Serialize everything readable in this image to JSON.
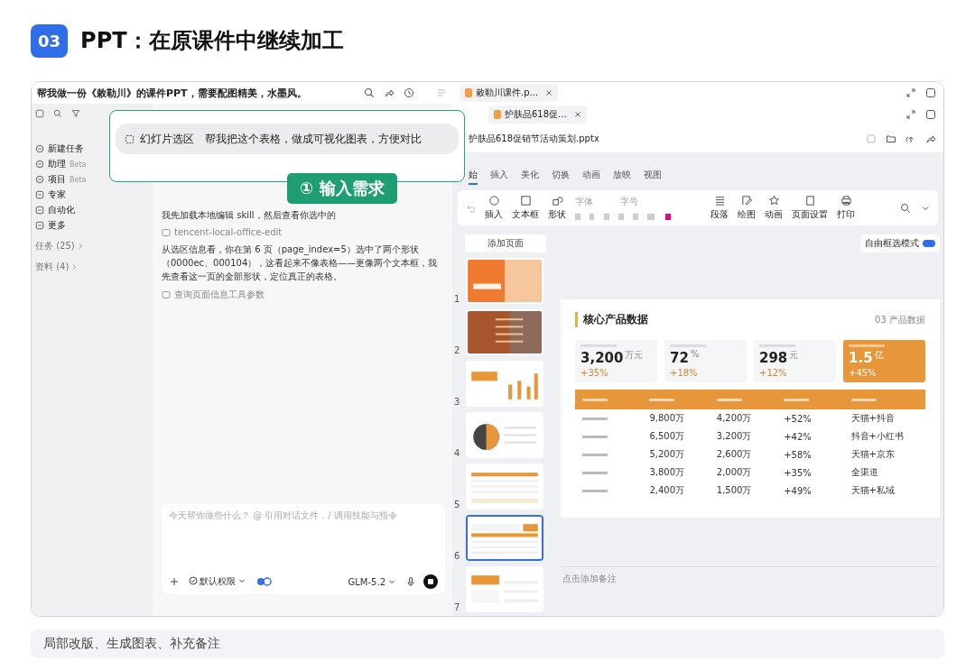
{
  "header": {
    "badge": "03",
    "title": "PPT：在原课件中继续加工"
  },
  "chat_window": {
    "title": "帮我做一份《敕勒川》的课件PPT，需要配图精美，水墨风。",
    "sidebar": {
      "items": [
        {
          "label": "新建任务"
        },
        {
          "label": "助理",
          "badge": "Beta"
        },
        {
          "label": "项目",
          "badge": "Beta"
        },
        {
          "label": "专家"
        },
        {
          "label": "自动化"
        },
        {
          "label": "更多"
        }
      ],
      "sections": [
        "任务 (25)",
        "资料 (4)"
      ]
    },
    "messages": [
      {
        "kind": "text",
        "text": "我先加载本地编辑 skill，然后查看你选中的"
      },
      {
        "kind": "tool",
        "text": "tencent-local-office-edit"
      },
      {
        "kind": "text",
        "text": "从选区信息看，你在第 6 页（page_index=5）选中了两个形状（0000ec、000104），这看起来不像表格——更像两个文本框，我先查看这一页的全部形状，定位真正的表格。"
      },
      {
        "kind": "tool",
        "text": "查询页面信息工具参数"
      }
    ],
    "composer": {
      "placeholder": "今天帮你做些什么？ @ 引用对话文件，/ 调用技能与指令",
      "permission": "默认权限",
      "model": "GLM-5.2"
    }
  },
  "overlay": {
    "chip": "幻灯片选区",
    "prompt": "帮我把这个表格，做成可视化图表，方便对比",
    "step": "① 输入需求"
  },
  "editor": {
    "outer_tab": "敕勒川课件.p...",
    "inner_tab": "护肤品618促...",
    "filename": "护肤品618促销节活动策划.pptx",
    "ribbon_tabs": [
      {
        "label": "始",
        "selected": true
      },
      {
        "label": "插入",
        "selected": false
      },
      {
        "label": "美化",
        "selected": false
      },
      {
        "label": "切换",
        "selected": false
      },
      {
        "label": "动画",
        "selected": false
      },
      {
        "label": "放映",
        "selected": false
      },
      {
        "label": "视图",
        "selected": false
      }
    ],
    "font_placeholder": "字体",
    "size_placeholder": "字号",
    "tools": [
      {
        "kind": "insert",
        "label": "插入"
      },
      {
        "kind": "textbox",
        "label": "文本框"
      },
      {
        "kind": "shape",
        "label": "形状"
      },
      {
        "kind": "paragraph",
        "label": "段落"
      },
      {
        "kind": "draw",
        "label": "绘图"
      },
      {
        "kind": "animation",
        "label": "动画"
      },
      {
        "kind": "page",
        "label": "页面设置"
      },
      {
        "kind": "print",
        "label": "打印"
      }
    ],
    "add_page": "添加页面",
    "select_mode": {
      "label": "自由框选模式",
      "on": true
    },
    "slides": [
      {
        "number": "1",
        "kind": "cover",
        "selected": false
      },
      {
        "number": "2",
        "kind": "agenda",
        "selected": false
      },
      {
        "number": "3",
        "kind": "bar",
        "selected": false
      },
      {
        "number": "4",
        "kind": "pie",
        "selected": false
      },
      {
        "number": "5",
        "kind": "table",
        "selected": false
      },
      {
        "number": "6",
        "kind": "stats",
        "selected": true
      },
      {
        "number": "7",
        "kind": "split",
        "selected": false
      }
    ],
    "slide": {
      "title": "核心产品数据",
      "section": "03 产品数据",
      "stats": [
        {
          "value": "3,200",
          "unit": "万元",
          "change": "+35%",
          "highlighted": false
        },
        {
          "value": "72",
          "unit": "%",
          "change": "+18%",
          "highlighted": false
        },
        {
          "value": "298",
          "unit": "元",
          "change": "+12%",
          "highlighted": false
        },
        {
          "value": "1.5",
          "unit": "亿",
          "change": "+45%",
          "highlighted": true
        }
      ],
      "rows": [
        [
          "9,800万",
          "4,200万",
          "+52%",
          "天猫+抖音"
        ],
        [
          "6,500万",
          "3,200万",
          "+42%",
          "抖音+小红书"
        ],
        [
          "5,200万",
          "2,600万",
          "+58%",
          "天猫+京东"
        ],
        [
          "3,800万",
          "2,000万",
          "+35%",
          "全渠道"
        ],
        [
          "2,400万",
          "1,500万",
          "+49%",
          "天猫+私域"
        ]
      ]
    },
    "notes_placeholder": "点击添加备注"
  },
  "footer": "局部改版、生成图表、补充备注"
}
